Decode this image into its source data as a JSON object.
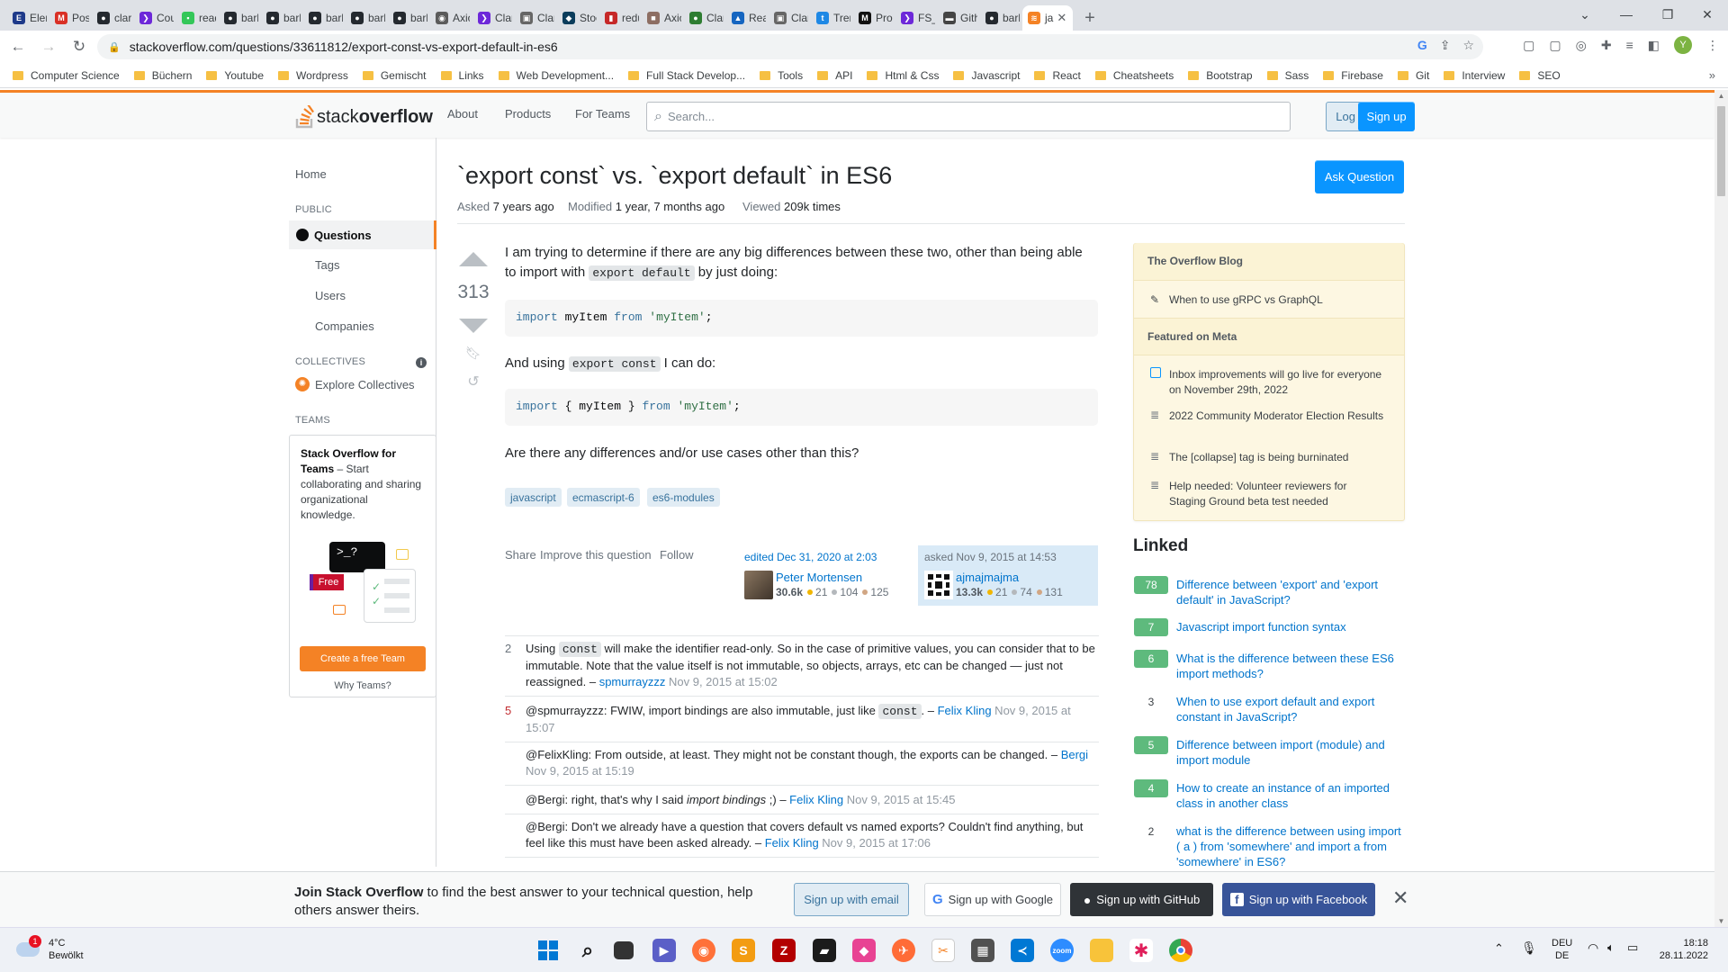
{
  "browser": {
    "tabs": [
      {
        "label": "Elem",
        "color": "#1e3a8a",
        "glyph": "E"
      },
      {
        "label": "Post",
        "color": "#d93025",
        "glyph": "M"
      },
      {
        "label": "claru",
        "color": "#24292f",
        "glyph": "●"
      },
      {
        "label": "Cour",
        "color": "#6d28d9",
        "glyph": "❯"
      },
      {
        "label": "read",
        "color": "#34c759",
        "glyph": "▪"
      },
      {
        "label": "barb",
        "color": "#24292f",
        "glyph": "●"
      },
      {
        "label": "barb",
        "color": "#24292f",
        "glyph": "●"
      },
      {
        "label": "barb",
        "color": "#24292f",
        "glyph": "●"
      },
      {
        "label": "barb",
        "color": "#24292f",
        "glyph": "●"
      },
      {
        "label": "barb",
        "color": "#24292f",
        "glyph": "●"
      },
      {
        "label": "Axio",
        "color": "#5b5b5b",
        "glyph": "◉"
      },
      {
        "label": "Claru",
        "color": "#6d28d9",
        "glyph": "❯"
      },
      {
        "label": "Claru",
        "color": "#666",
        "glyph": "▣"
      },
      {
        "label": "Stock",
        "color": "#0b3d5c",
        "glyph": "◆"
      },
      {
        "label": "redu",
        "color": "#c62828",
        "glyph": "▮"
      },
      {
        "label": "Axio",
        "color": "#8d6e63",
        "glyph": "■"
      },
      {
        "label": "Claru",
        "color": "#2e7d32",
        "glyph": "●"
      },
      {
        "label": "Reac",
        "color": "#1565c0",
        "glyph": "▲"
      },
      {
        "label": "Claru",
        "color": "#666",
        "glyph": "▣"
      },
      {
        "label": "Trem",
        "color": "#1e88e5",
        "glyph": "t"
      },
      {
        "label": "Pron",
        "color": "#111",
        "glyph": "M"
      },
      {
        "label": "FS_F",
        "color": "#6d28d9",
        "glyph": "❯"
      },
      {
        "label": "Gith",
        "color": "#444",
        "glyph": "▬"
      },
      {
        "label": "barb",
        "color": "#24292f",
        "glyph": "●"
      }
    ],
    "active_tab": {
      "label": "ja",
      "color": "#f48225",
      "glyph": "≋"
    },
    "url": "stackoverflow.com/questions/33611812/export-const-vs-export-default-in-es6",
    "profile_initial": "Y",
    "bookmarks": [
      "Computer Science",
      "Büchern",
      "Youtube",
      "Wordpress",
      "Gemischt",
      "Links",
      "Web Development...",
      "Full Stack Develop...",
      "Tools",
      "API",
      "Html & Css",
      "Javascript",
      "React",
      "Cheatsheets",
      "Bootstrap",
      "Sass",
      "Firebase",
      "Git",
      "Interview",
      "SEO"
    ],
    "bookmarks_more": "»"
  },
  "so": {
    "logo_plain": "stack",
    "logo_bold": "overflow",
    "nav": [
      "About",
      "Products",
      "For Teams"
    ],
    "search_placeholder": "Search...",
    "login": "Log in",
    "signup": "Sign up",
    "left_nav": {
      "home": "Home",
      "public": "PUBLIC",
      "questions": "Questions",
      "tags": "Tags",
      "users": "Users",
      "companies": "Companies",
      "collectives": "COLLECTIVES",
      "explore": "Explore Collectives",
      "teams": "TEAMS",
      "teams_title": "Stack Overflow for Teams",
      "teams_desc": " – Start collaborating and sharing organizational knowledge.",
      "free_badge": "Free",
      "create_team": "Create a free Team",
      "why_teams": "Why Teams?"
    }
  },
  "question": {
    "title": "`export const` vs. `export default` in ES6",
    "ask_button": "Ask Question",
    "asked_label": "Asked",
    "asked_value": "7 years ago",
    "modified_label": "Modified",
    "modified_value": "1 year, 7 months ago",
    "viewed_label": "Viewed",
    "viewed_value": "209k times",
    "score": "313",
    "p1_a": "I am trying to determine if there are any big differences between these two, other than being able to import with ",
    "p1_code": "export default",
    "p1_b": " by just doing:",
    "code1": {
      "kw1": "import",
      "mid": " myItem ",
      "kw2": "from",
      "sp": " ",
      "str": "'myItem'",
      "end": ";"
    },
    "p2_a": "And using ",
    "p2_code": "export const",
    "p2_b": " I can do:",
    "code2": {
      "kw1": "import",
      "mid": " { myItem } ",
      "kw2": "from",
      "sp": " ",
      "str": "'myItem'",
      "end": ";"
    },
    "p3": "Are there any differences and/or use cases other than this?",
    "tags": [
      "javascript",
      "ecmascript-6",
      "es6-modules"
    ],
    "actions": [
      "Share",
      "Improve this question",
      "Follow"
    ],
    "editor": {
      "when": "edited Dec 31, 2020 at 2:03",
      "name": "Peter Mortensen",
      "rep": "30.6k",
      "gold": "21",
      "silver": "104",
      "bronze": "125"
    },
    "owner": {
      "when": "asked Nov 9, 2015 at 14:53",
      "name": "ajmajmajma",
      "rep": "13.3k",
      "gold": "21",
      "silver": "74",
      "bronze": "131"
    }
  },
  "comments": [
    {
      "score": "2",
      "pre": "Using ",
      "code": "const",
      "text": " will make the identifier read-only. So in the case of primitive values, you can consider that to be immutable. Note that the value itself is not immutable, so objects, arrays, etc can be changed — just not reassigned.",
      "sep": " – ",
      "user": "spmurrayzzz",
      "date": " Nov 9, 2015 at 15:02"
    },
    {
      "score": "5",
      "pre": "@spmurrayzzz: FWIW, import bindings are also immutable, just like ",
      "code": "const",
      "text": ".",
      "sep": " – ",
      "user": "Felix Kling",
      "date": " Nov 9, 2015 at 15:07"
    },
    {
      "score": "",
      "pre": "@FelixKling: From outside, at least. They might not be constant though, the exports can be changed.",
      "code": "",
      "text": "",
      "sep": " – ",
      "user": "Bergi",
      "date": " Nov 9, 2015 at 15:19"
    },
    {
      "score": "",
      "pre": "@Bergi: right, that's why I said ",
      "code": "",
      "ital": "import bindings",
      "text": " ;)",
      "sep": " – ",
      "user": "Felix Kling",
      "date": " Nov 9, 2015 at 15:45"
    },
    {
      "score": "",
      "pre": "@Bergi: Don't we already have a question that covers default vs named exports? Couldn't find anything, but feel like this must have been asked already.",
      "code": "",
      "text": "",
      "sep": " – ",
      "user": "Felix Kling",
      "date": " Nov 9, 2015 at 17:06"
    }
  ],
  "sidebar": {
    "blog_head": "The Overflow Blog",
    "blog_item": "When to use gRPC vs GraphQL",
    "meta_head": "Featured on Meta",
    "meta_items": [
      "Inbox improvements will go live for everyone on November 29th, 2022",
      "2022 Community Moderator Election Results",
      "The [collapse] tag is being burninated",
      "Help needed: Volunteer reviewers for Staging Ground beta test needed"
    ],
    "linked_title": "Linked",
    "linked": [
      {
        "score": "78",
        "accepted": true,
        "text": "Difference between 'export' and 'export default' in JavaScript?"
      },
      {
        "score": "7",
        "accepted": true,
        "text": "Javascript import function syntax"
      },
      {
        "score": "6",
        "accepted": true,
        "text": "What is the difference between these ES6 import methods?"
      },
      {
        "score": "3",
        "accepted": false,
        "text": "When to use export default and export constant in JavaScript?"
      },
      {
        "score": "5",
        "accepted": true,
        "text": "Difference between import (module) and import module"
      },
      {
        "score": "4",
        "accepted": true,
        "text": "How to create an instance of an imported class in another class"
      },
      {
        "score": "2",
        "accepted": false,
        "text": "what is the difference between using import ( a ) from 'somewhere' and import a from 'somewhere' in ES6?"
      }
    ]
  },
  "banner": {
    "bold": "Join Stack Overflow",
    "text": " to find the best answer to your technical question, help others answer theirs.",
    "email": "Sign up with email",
    "google": "Sign up with Google",
    "github": "Sign up with GitHub",
    "facebook": "Sign up with Facebook"
  },
  "taskbar": {
    "temp": "4°C",
    "weather": "Bewölkt",
    "weather_badge": "1",
    "lang1": "DEU",
    "lang2": "DE",
    "time": "18:18",
    "date": "28.11.2022"
  }
}
